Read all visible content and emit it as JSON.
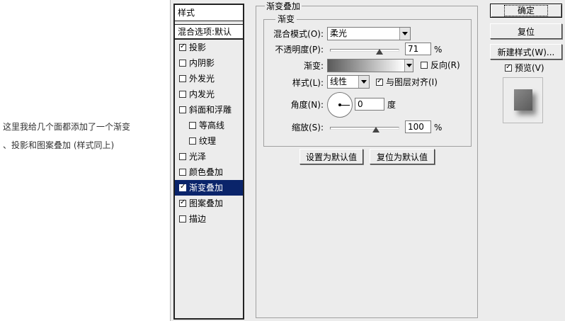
{
  "note": {
    "line1": "这里我给几个面都添加了一个渐变",
    "line2": "、投影和图案叠加 (样式同上)"
  },
  "styles_list": {
    "header": "样式",
    "blend_options": "混合选项:默认",
    "items": [
      {
        "label": "投影",
        "checked": true,
        "sub": false,
        "selected": false
      },
      {
        "label": "内阴影",
        "checked": false,
        "sub": false,
        "selected": false
      },
      {
        "label": "外发光",
        "checked": false,
        "sub": false,
        "selected": false
      },
      {
        "label": "内发光",
        "checked": false,
        "sub": false,
        "selected": false
      },
      {
        "label": "斜面和浮雕",
        "checked": false,
        "sub": false,
        "selected": false
      },
      {
        "label": "等高线",
        "checked": false,
        "sub": true,
        "selected": false
      },
      {
        "label": "纹理",
        "checked": false,
        "sub": true,
        "selected": false
      },
      {
        "label": "光泽",
        "checked": false,
        "sub": false,
        "selected": false
      },
      {
        "label": "颜色叠加",
        "checked": false,
        "sub": false,
        "selected": false
      },
      {
        "label": "渐变叠加",
        "checked": true,
        "sub": false,
        "selected": true
      },
      {
        "label": "图案叠加",
        "checked": true,
        "sub": false,
        "selected": false
      },
      {
        "label": "描边",
        "checked": false,
        "sub": false,
        "selected": false
      }
    ]
  },
  "panel": {
    "title": "渐变叠加",
    "group_title": "渐变",
    "blend_mode_label": "混合模式(O):",
    "blend_mode_value": "柔光",
    "opacity_label": "不透明度(P):",
    "opacity_value": "71",
    "opacity_unit": "%",
    "gradient_label": "渐变:",
    "reverse_label": "反向(R)",
    "reverse_checked": false,
    "style_label": "样式(L):",
    "style_value": "线性",
    "align_label": "与图层对齐(I)",
    "align_checked": true,
    "angle_label": "角度(N):",
    "angle_value": "0",
    "angle_unit": "度",
    "scale_label": "缩放(S):",
    "scale_value": "100",
    "scale_unit": "%",
    "make_default": "设置为默认值",
    "reset_default": "复位为默认值"
  },
  "right": {
    "ok": "确定",
    "reset": "复位",
    "new_style": "新建样式(W)...",
    "preview_label": "预览(V)",
    "preview_checked": true
  }
}
